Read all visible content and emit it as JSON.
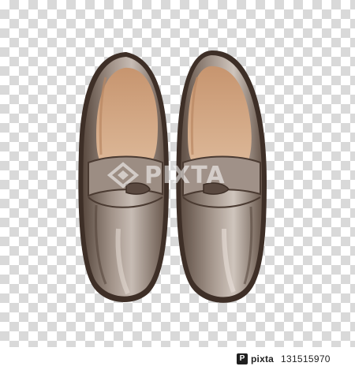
{
  "image": {
    "subject": "pair of brown leather penny loafers, top view, watercolor illustration",
    "colors": {
      "leather": "#8c7b70",
      "leather_dark": "#4d3b30",
      "leather_light": "#c9bdb4",
      "lining": "#d1a584",
      "checker": "#d9d9d9"
    }
  },
  "watermark": {
    "text": "PIXTA",
    "icon": "pixta-logo-icon"
  },
  "footer": {
    "brand": "pixta",
    "brand_icon": "pixta-mark-icon",
    "image_id": "131515970"
  }
}
